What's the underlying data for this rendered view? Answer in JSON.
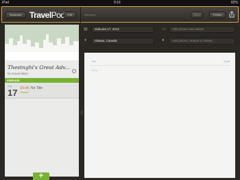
{
  "status": {
    "carrier": "iPad",
    "time": "9:16",
    "battery": "82%"
  },
  "topbar": {
    "bookcase_label": "Bookcase",
    "logo_travel": "Travel",
    "logo_pod": "Pod",
    "edit_label": "Edit",
    "entry_title": "Welcome",
    "save_label": "Save",
    "publish_label": "Publish"
  },
  "trip": {
    "name": "Thestnghi's Great Adv...",
    "no_travel_dates": "No travel dates",
    "group_label": "elokuuta"
  },
  "entry": {
    "month": "Aug",
    "day": "17",
    "draft": "(Draft)",
    "title": "No Title",
    "place": "Ottawa"
  },
  "editor": {
    "date": "elokuuta 17, 2014",
    "photos_placeholder": "Add photos and videos",
    "location": "Ottawa, Canada",
    "places_placeholder": "Add places I stayed or visited",
    "title_placeholder": "Title",
    "draft_label": "Draft",
    "story_placeholder": "Story"
  },
  "sidebar": {
    "add_label": "+"
  },
  "colors": {
    "accent_green": "#78b233",
    "highlight_border": "#e0a34a"
  }
}
